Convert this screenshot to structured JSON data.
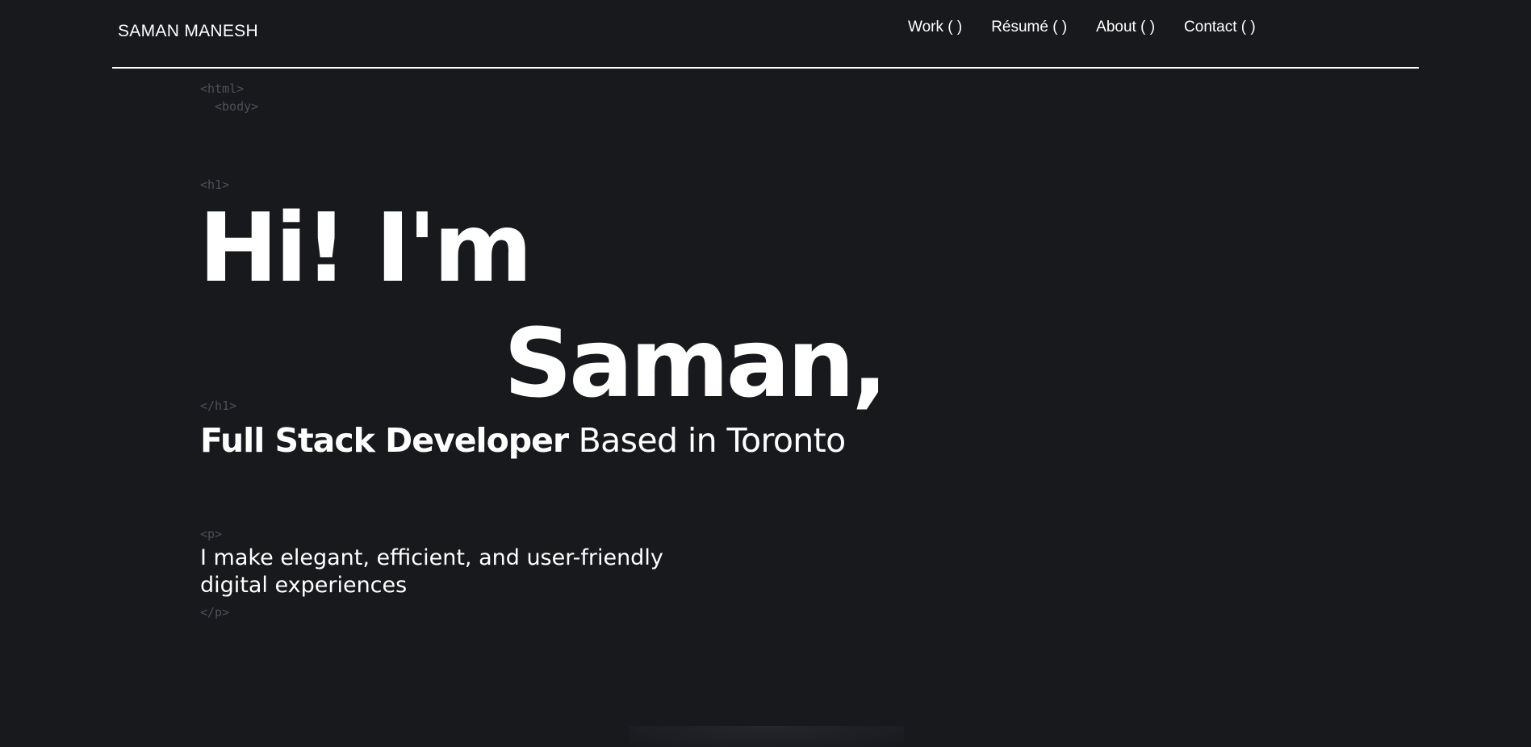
{
  "header": {
    "brand": "SAMAN MANESH",
    "nav": [
      {
        "label": "Work ( )"
      },
      {
        "label": "Résumé ( )"
      },
      {
        "label": "About ( )"
      },
      {
        "label": "Contact ( )"
      }
    ]
  },
  "code_tags": {
    "html_open": "<html>",
    "body_open": "<body>",
    "h1_open": "<h1>",
    "h1_close": "</h1>",
    "p_open": "<p>",
    "p_close": "</p>"
  },
  "hero": {
    "greeting_part1": "Hi!",
    "greeting_part2": "I'm",
    "name": "Saman,",
    "role": "Full Stack Developer",
    "location": "Based in Toronto",
    "intro_line1": "I make elegant, efficient, and user-friendly",
    "intro_line2": "digital experiences"
  },
  "colors": {
    "background": "#18191d",
    "text": "#ffffff",
    "code_tag": "#4e5057"
  }
}
